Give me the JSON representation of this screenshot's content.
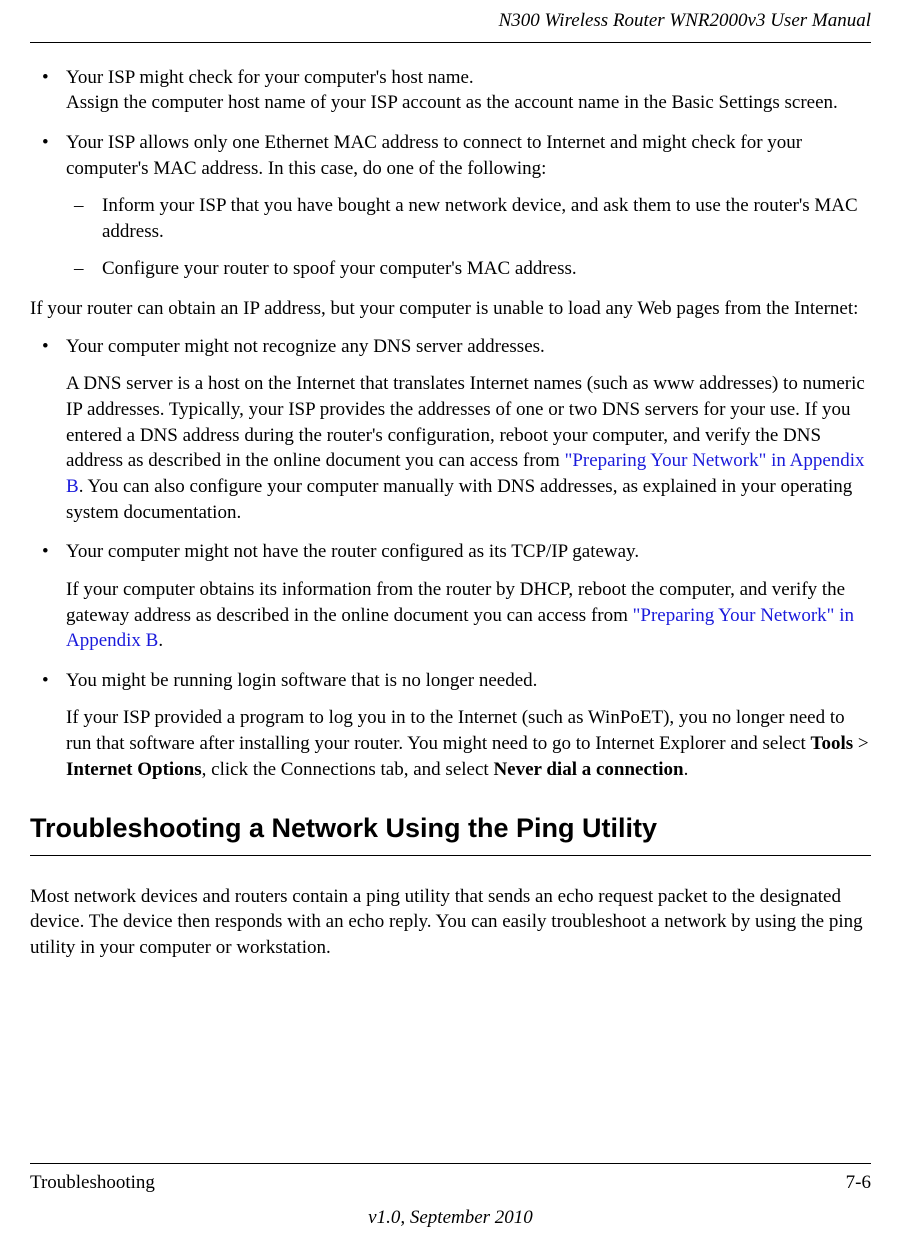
{
  "header": {
    "title": "N300 Wireless Router WNR2000v3 User Manual"
  },
  "content": {
    "bullets1": [
      {
        "text": "Your ISP might check for your computer's host name.",
        "extra": "Assign the computer host name of your ISP account as the account name in the Basic Settings screen."
      },
      {
        "text": "Your ISP allows only one Ethernet MAC address to connect to Internet and might check for your computer's MAC address. In this case, do one of the following:",
        "sub": [
          "Inform your ISP that you have bought a new network device, and ask them to use the router's MAC address.",
          "Configure your router to spoof your computer's MAC address."
        ]
      }
    ],
    "para1": "If your router can obtain an IP address, but your computer is unable to load any Web pages from the Internet:",
    "bullets2": {
      "b0": {
        "text": "Your computer might not recognize any DNS server addresses.",
        "sub_pre": "A DNS server is a host on the Internet that translates Internet names (such as www addresses) to numeric IP addresses. Typically, your ISP provides the addresses of one or two DNS servers for your use. If you entered a DNS address during the router's configuration, reboot your computer, and verify the DNS address as described in the online document you can access from ",
        "link": "\"Preparing Your Network\" in Appendix B",
        "sub_post": ". You can also configure your computer manually with DNS addresses, as explained in your operating system documentation."
      },
      "b1": {
        "text": "Your computer might not have the router configured as its TCP/IP gateway.",
        "sub_pre": "If your computer obtains its information from the router by DHCP, reboot the computer, and verify the gateway address as described in the online document you can access from ",
        "link": "\"Preparing Your Network\" in Appendix B",
        "sub_post": "."
      },
      "b2": {
        "text": "You might be running login software that is no longer needed.",
        "sub_pre": "If your ISP provided a program to log you in to the Internet (such as WinPoET), you no longer need to run that software after installing your router. You might need to go to Internet Explorer and select ",
        "bold1": "Tools",
        "mid1": " > ",
        "bold2": "Internet Options",
        "mid2": ", click the Connections tab, and select ",
        "bold3": "Never dial a connection",
        "post": "."
      }
    },
    "heading": "Troubleshooting a Network Using the Ping Utility",
    "para2": "Most network devices and routers contain a ping utility that sends an echo request packet to the designated device. The device then responds with an echo reply. You can easily troubleshoot a network by using the ping utility in your computer or workstation."
  },
  "footer": {
    "left": "Troubleshooting",
    "right": "7-6",
    "version": "v1.0, September 2010"
  }
}
